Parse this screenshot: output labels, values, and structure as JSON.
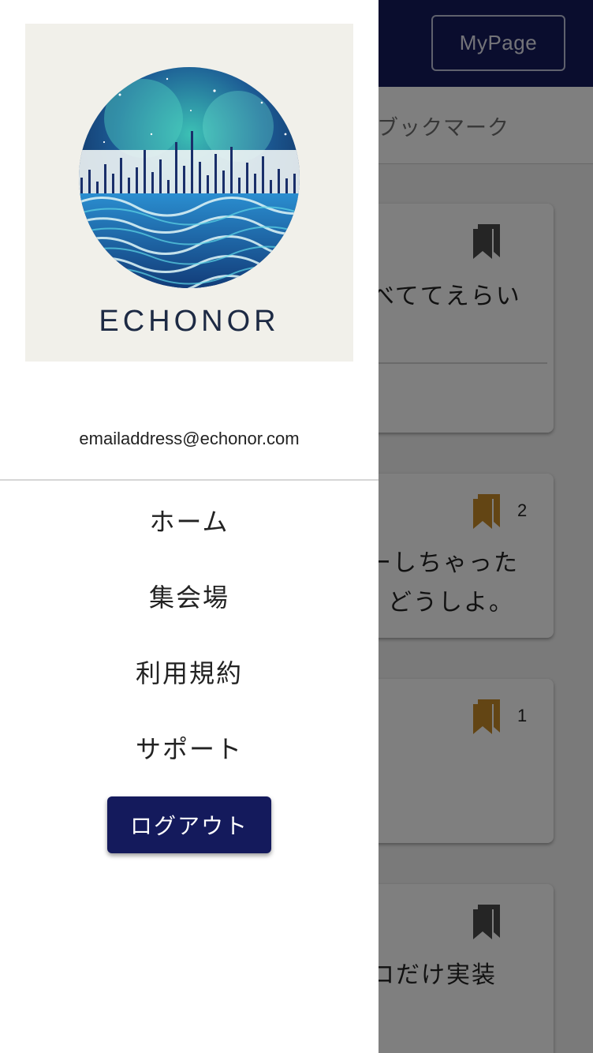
{
  "header": {
    "mypage_label": "MyPage"
  },
  "tabs": {
    "bookmark_label": "ブックマーク"
  },
  "cards": [
    {
      "text_line1": "べててえらい",
      "text_line2": "",
      "bookmark_count": "",
      "bookmarked": false
    },
    {
      "text_line1": "ーしちゃった",
      "text_line2": "どうしよ。",
      "bookmark_count": "2",
      "bookmarked": true
    },
    {
      "text_line1": "",
      "text_line2": "",
      "bookmark_count": "1",
      "bookmarked": true
    },
    {
      "text_line1": "ロだけ実装",
      "text_line2": "",
      "bookmark_count": "",
      "bookmarked": false
    }
  ],
  "drawer": {
    "logo_text": "ECHONOR",
    "email": "emailaddress@echonor.com",
    "nav": [
      "ホーム",
      "集会場",
      "利用規約",
      "サポート"
    ],
    "logout_label": "ログアウト"
  },
  "colors": {
    "brand_navy": "#141a5c",
    "bookmark_active": "#c78a28",
    "bookmark_inactive": "#4a4a4a"
  }
}
